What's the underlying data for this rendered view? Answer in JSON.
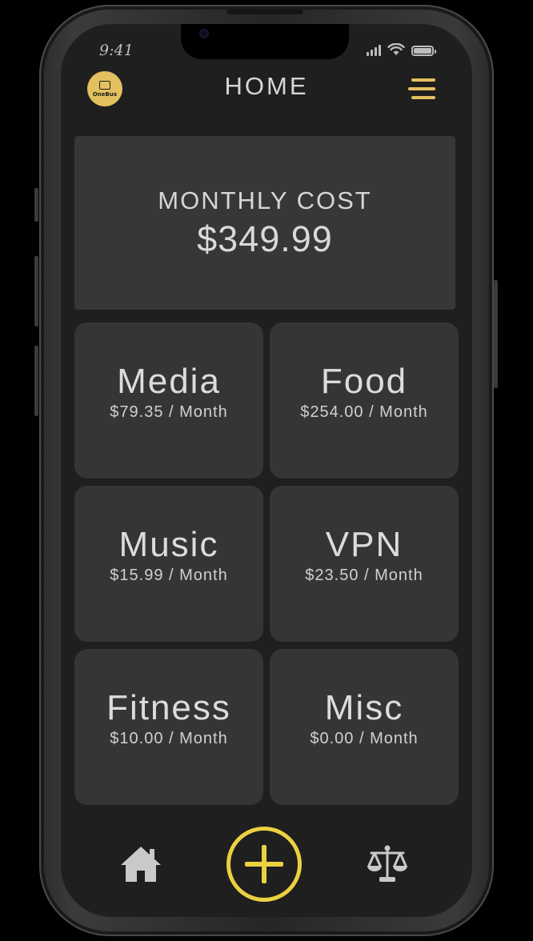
{
  "status_bar": {
    "time": "9:41"
  },
  "header": {
    "logo_text": "OneBux",
    "title": "HOME"
  },
  "summary": {
    "label": "MONTHLY COST",
    "value": "$349.99"
  },
  "categories": [
    {
      "name": "Media",
      "price": "$79.35 / Month"
    },
    {
      "name": "Food",
      "price": "$254.00 / Month"
    },
    {
      "name": "Music",
      "price": "$15.99 / Month"
    },
    {
      "name": "VPN",
      "price": "$23.50 / Month"
    },
    {
      "name": "Fitness",
      "price": "$10.00 / Month"
    },
    {
      "name": "Misc",
      "price": "$0.00 / Month"
    }
  ],
  "colors": {
    "accent": "#e3c15e",
    "add_button": "#ebd141",
    "background": "#1f1f1f",
    "card": "#353535"
  },
  "icons": {
    "menu": "hamburger-menu-icon",
    "home": "home-icon",
    "add": "plus-circle-icon",
    "compare": "balance-scale-icon"
  }
}
